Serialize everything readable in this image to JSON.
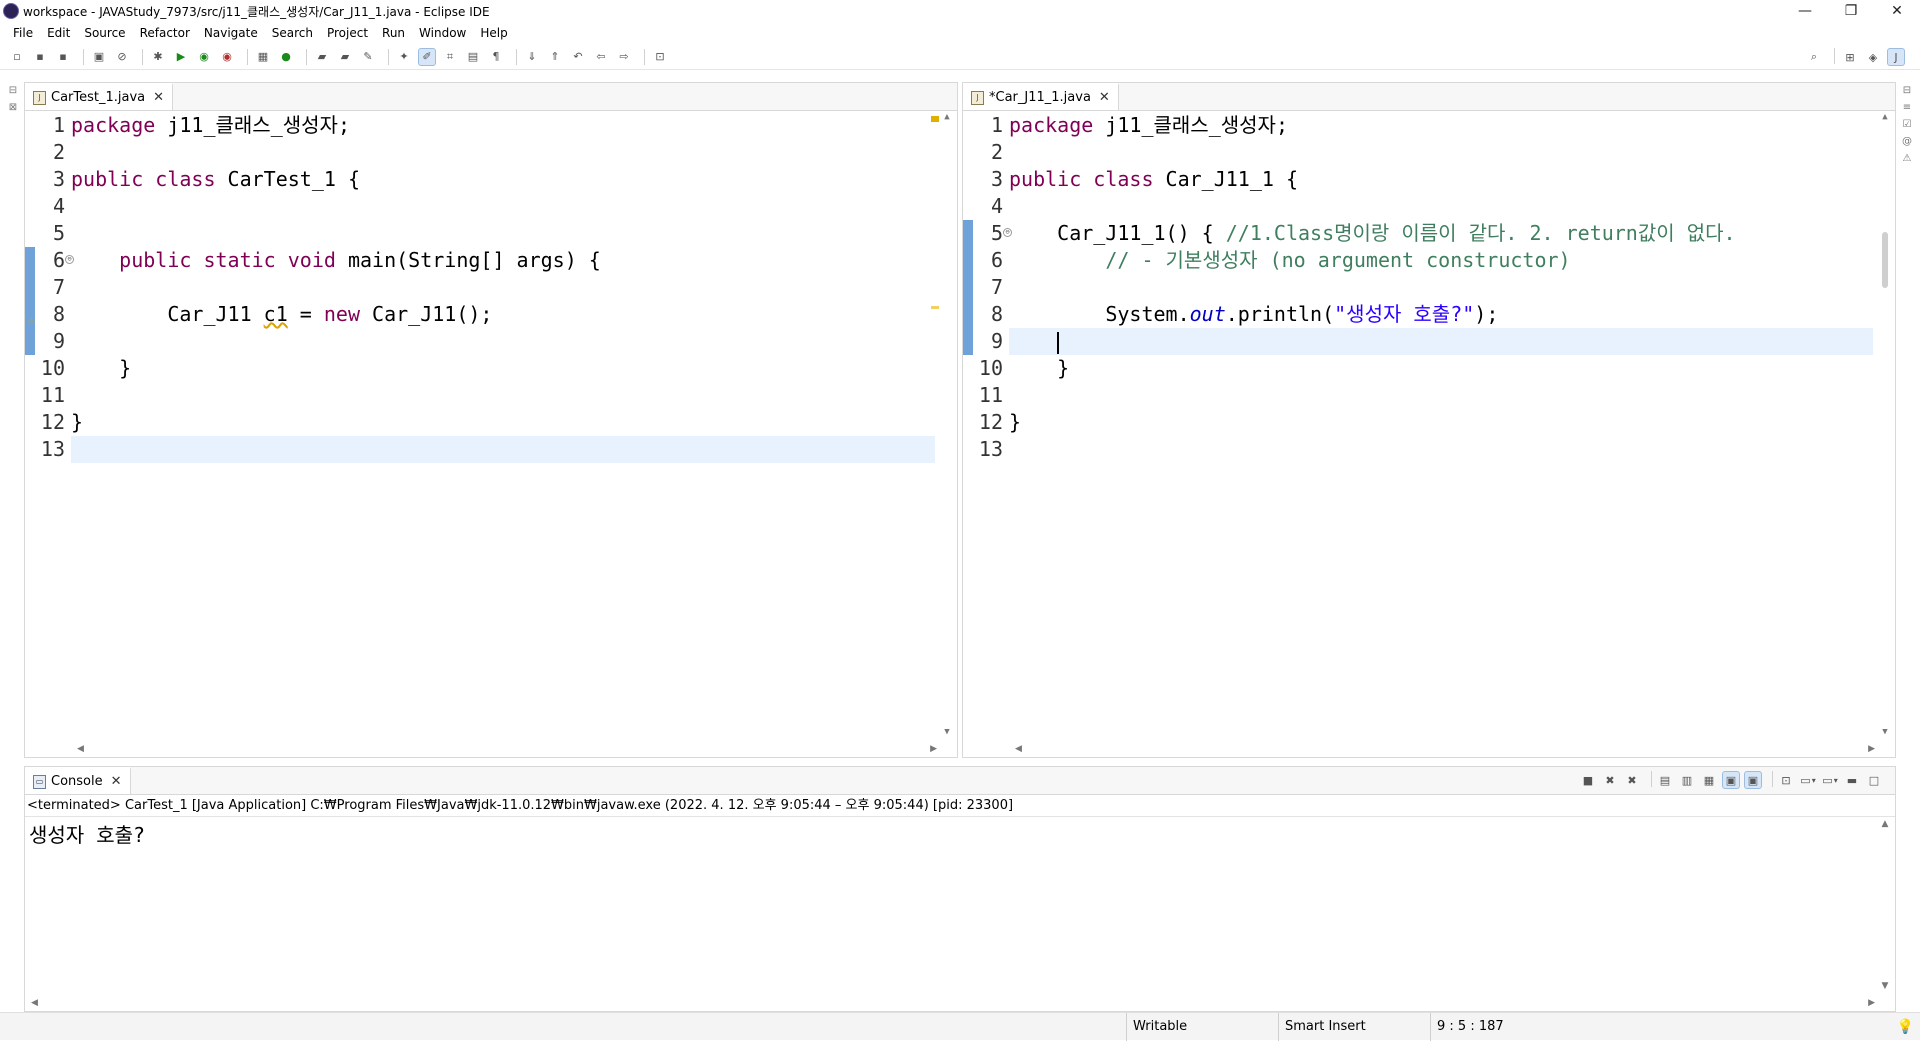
{
  "window": {
    "title": "workspace - JAVAStudy_7973/src/j11_클래스_생성자/Car_J11_1.java - Eclipse IDE",
    "controls": {
      "minimize": "—",
      "restore": "❐",
      "close": "✕"
    }
  },
  "menu": [
    "File",
    "Edit",
    "Source",
    "Refactor",
    "Navigate",
    "Search",
    "Project",
    "Run",
    "Window",
    "Help"
  ],
  "left_editor": {
    "tab_label": "CarTest_1.java",
    "lines": [
      {
        "n": "1"
      },
      {
        "n": "2"
      },
      {
        "n": "3"
      },
      {
        "n": "4"
      },
      {
        "n": "5"
      },
      {
        "n": "6"
      },
      {
        "n": "7"
      },
      {
        "n": "8"
      },
      {
        "n": "9"
      },
      {
        "n": "10"
      },
      {
        "n": "11"
      },
      {
        "n": "12"
      },
      {
        "n": "13"
      }
    ],
    "code": {
      "l1_kw": "package",
      "l1_rest": " j11_클래스_생성자;",
      "l3_kw1": "public",
      "l3_kw2": "class",
      "l3_rest": " CarTest_1 {",
      "l6_indent": "    ",
      "l6_kw1": "public",
      "l6_kw2": "static",
      "l6_kw3": "void",
      "l6_rest": " main(String[] args) {",
      "l8_indent": "        ",
      "l8_type": "Car_J11 ",
      "l8_var": "c1",
      "l8_eq": " = ",
      "l8_kw": "new",
      "l8_rest": " Car_J11();",
      "l10": "    }",
      "l12": "}"
    }
  },
  "right_editor": {
    "tab_label": "*Car_J11_1.java",
    "lines": [
      {
        "n": "1"
      },
      {
        "n": "2"
      },
      {
        "n": "3"
      },
      {
        "n": "4"
      },
      {
        "n": "5"
      },
      {
        "n": "6"
      },
      {
        "n": "7"
      },
      {
        "n": "8"
      },
      {
        "n": "9"
      },
      {
        "n": "10"
      },
      {
        "n": "11"
      },
      {
        "n": "12"
      },
      {
        "n": "13"
      }
    ],
    "code": {
      "l1_kw": "package",
      "l1_rest": " j11_클래스_생성자;",
      "l3_kw1": "public",
      "l3_kw2": "class",
      "l3_rest": " Car_J11_1 {",
      "l5_code": "    Car_J11_1() { ",
      "l5_cmt": "//1.Class명이랑 이름이 같다. 2. return값이 없다.",
      "l6_cmt": "        // - 기본생성자 (no argument constructor)",
      "l8_pre": "        System.",
      "l8_fld": "out",
      "l8_mid": ".println(",
      "l8_str": "\"생성자 호출?\"",
      "l8_end": ");",
      "l9_indent": "    ",
      "l10": "    }",
      "l12": "}"
    }
  },
  "console": {
    "tab_label": "Console",
    "status": "<terminated> CarTest_1 [Java Application] C:₩Program Files₩Java₩jdk-11.0.12₩bin₩javaw.exe  (2022. 4. 12. 오후 9:05:44 – 오후 9:05:44) [pid: 23300]",
    "output": "생성자 호출?"
  },
  "statusbar": {
    "writable": "Writable",
    "insert_mode": "Smart Insert",
    "position": "9 : 5 : 187"
  },
  "colors": {
    "keyword": "#7f0055",
    "string": "#2a00ff",
    "comment": "#3f7f5f",
    "field": "#0000c0",
    "current_line": "#e8f2fe",
    "change_ruler": "#6fa2d8"
  }
}
